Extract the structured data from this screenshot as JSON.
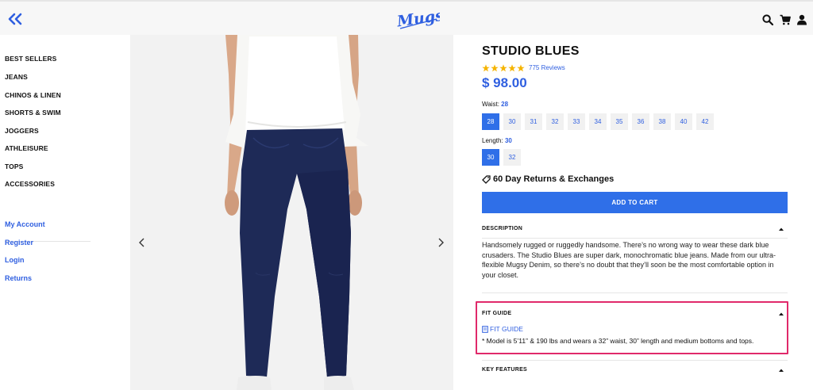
{
  "header": {
    "logo_text": "Mugsy",
    "brand_color": "#2f5fe0",
    "icons": [
      "double-chevron-left-icon",
      "search-icon",
      "cart-icon",
      "user-icon"
    ]
  },
  "sidebar": {
    "categories": [
      {
        "label": "BEST SELLERS"
      },
      {
        "label": "JEANS"
      },
      {
        "label": "CHINOS & LINEN"
      },
      {
        "label": "SHORTS & SWIM"
      },
      {
        "label": "JOGGERS"
      },
      {
        "label": "ATHLEISURE"
      },
      {
        "label": "TOPS"
      },
      {
        "label": "ACCESSORIES"
      }
    ],
    "account_links": [
      {
        "label": "My Account"
      },
      {
        "label": "Register"
      },
      {
        "label": "Login"
      },
      {
        "label": "Returns"
      }
    ]
  },
  "product": {
    "title": "STUDIO BLUES",
    "rating_stars": 5,
    "reviews": "775 Reviews",
    "price": "$ 98.00",
    "waist_label": "Waist:",
    "waist_value": "28",
    "waist_sizes": [
      "28",
      "30",
      "31",
      "32",
      "33",
      "34",
      "35",
      "36",
      "38",
      "40",
      "42"
    ],
    "selected_waist": "28",
    "length_label": "Length:",
    "length_value": "30",
    "length_sizes": [
      "30",
      "32"
    ],
    "selected_length": "30",
    "returns_text": "60 Day Returns & Exchanges",
    "add_to_cart": "ADD TO CART",
    "description_title": "DESCRIPTION",
    "description_text": "Handsomely rugged or ruggedly handsome. There’s no wrong way to wear these dark blue crusaders. The Studio Blues are super dark, monochromatic blue jeans. Made from our ultra-flexible Mugsy Denim, so there’s no doubt that they’ll soon be the most comfortable option in your closet.",
    "fit_guide_title": "FIT GUIDE",
    "fit_guide_link": "FIT GUIDE",
    "fit_guide_note": "* Model is 5’11” & 190 lbs and wears a 32” waist, 30” length and medium bottoms and tops.",
    "key_features_title": "KEY FEATURES",
    "accent_color": "#2f6fe8",
    "highlight_color": "#e0296a"
  }
}
